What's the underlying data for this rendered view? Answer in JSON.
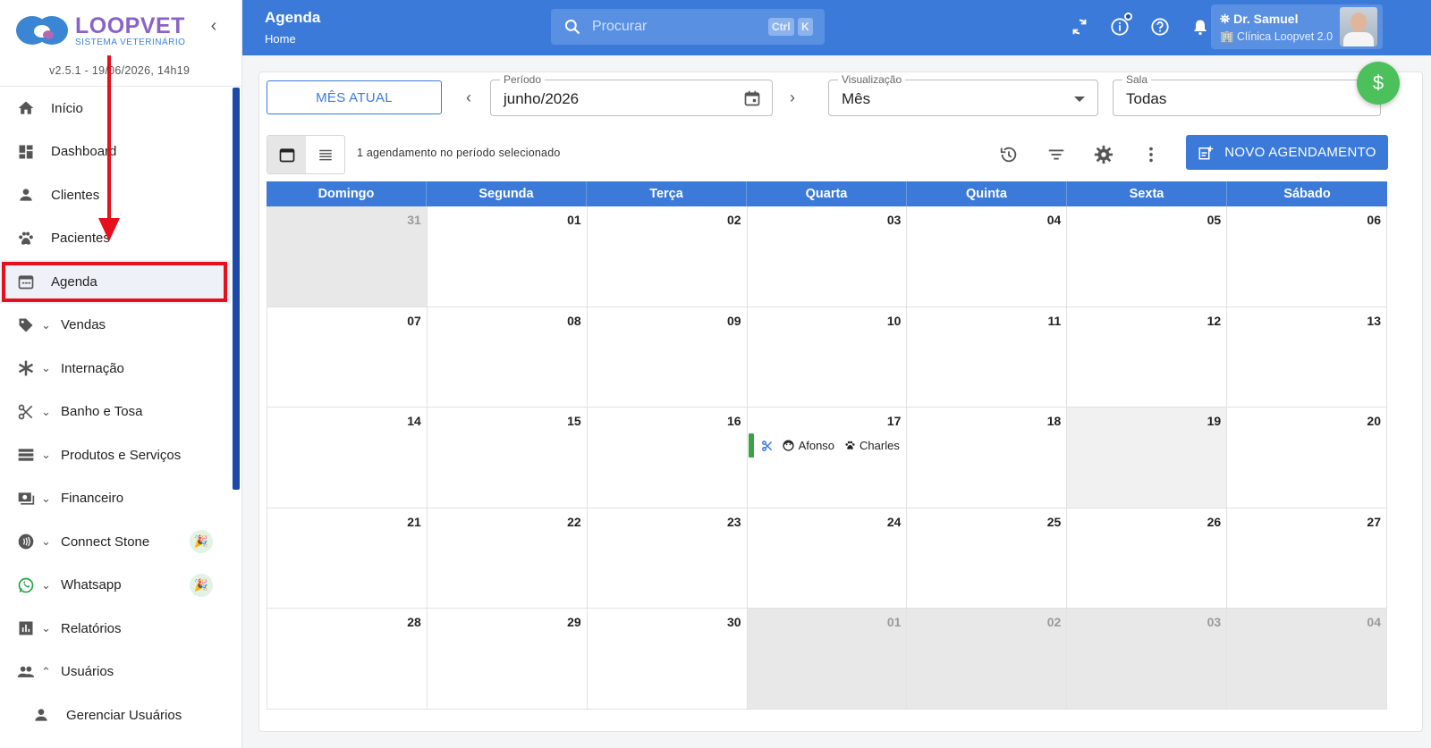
{
  "sidebar": {
    "logo_name": "LOOPVET",
    "logo_sub": "SISTEMA VETERINÁRIO",
    "version": "v2.5.1 - 19/06/2026, 14h19",
    "items": [
      {
        "label": "Início"
      },
      {
        "label": "Dashboard"
      },
      {
        "label": "Clientes"
      },
      {
        "label": "Pacientes"
      },
      {
        "label": "Agenda"
      },
      {
        "label": "Vendas"
      },
      {
        "label": "Internação"
      },
      {
        "label": "Banho e Tosa"
      },
      {
        "label": "Produtos e Serviços"
      },
      {
        "label": "Financeiro"
      },
      {
        "label": "Connect Stone"
      },
      {
        "label": "Whatsapp"
      },
      {
        "label": "Relatórios"
      },
      {
        "label": "Usuários"
      }
    ],
    "sub_items": [
      {
        "label": "Gerenciar Usuários"
      }
    ]
  },
  "header": {
    "title": "Agenda",
    "breadcrumb": "Home",
    "search_placeholder": "Procurar",
    "kbd_ctrl": "Ctrl",
    "kbd_k": "K",
    "user_name": "Dr. Samuel",
    "user_clinic": "Clínica Loopvet 2.0"
  },
  "toolbar": {
    "current_month_label": "MÊS ATUAL",
    "period_label": "Período",
    "period_value": "junho/2026",
    "view_label": "Visualização",
    "view_value": "Mês",
    "room_label": "Sala",
    "room_value": "Todas",
    "fab_label": "$",
    "count_text": "1 agendamento no período selecionado",
    "new_button_label": "NOVO AGENDAMENTO"
  },
  "calendar": {
    "weekdays": [
      "Domingo",
      "Segunda",
      "Terça",
      "Quarta",
      "Quinta",
      "Sexta",
      "Sábado"
    ],
    "days": [
      {
        "n": "31",
        "out": true
      },
      {
        "n": "01"
      },
      {
        "n": "02"
      },
      {
        "n": "03"
      },
      {
        "n": "04"
      },
      {
        "n": "05"
      },
      {
        "n": "06"
      },
      {
        "n": "07"
      },
      {
        "n": "08"
      },
      {
        "n": "09"
      },
      {
        "n": "10"
      },
      {
        "n": "11"
      },
      {
        "n": "12"
      },
      {
        "n": "13"
      },
      {
        "n": "14"
      },
      {
        "n": "15"
      },
      {
        "n": "16"
      },
      {
        "n": "17",
        "event": true
      },
      {
        "n": "18"
      },
      {
        "n": "19",
        "shaded": true
      },
      {
        "n": "20"
      },
      {
        "n": "21"
      },
      {
        "n": "22"
      },
      {
        "n": "23"
      },
      {
        "n": "24"
      },
      {
        "n": "25"
      },
      {
        "n": "26"
      },
      {
        "n": "27"
      },
      {
        "n": "28"
      },
      {
        "n": "29"
      },
      {
        "n": "30"
      },
      {
        "n": "01",
        "out": true
      },
      {
        "n": "02",
        "out": true
      },
      {
        "n": "03",
        "out": true
      },
      {
        "n": "04",
        "out": true
      }
    ],
    "event": {
      "client": "Afonso",
      "pet": "Charles",
      "status_color": "#3aa34a"
    }
  },
  "colors": {
    "primary": "#3b7ad9",
    "highlight_red": "#e5101b",
    "success": "#4cc05a"
  }
}
